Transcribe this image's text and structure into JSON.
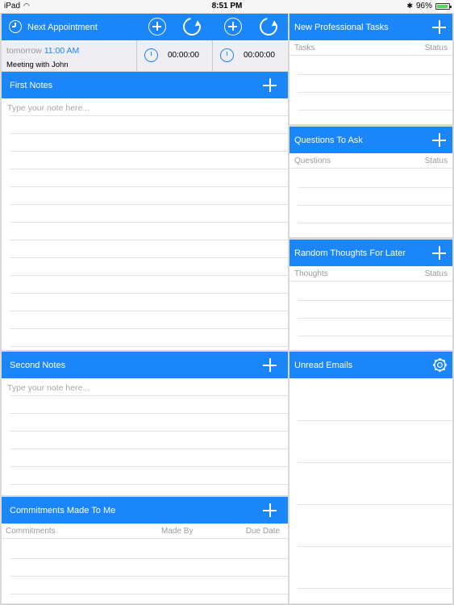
{
  "status_bar": {
    "device": "iPad",
    "time": "8:51 PM",
    "battery": "96%",
    "battery_level": 0.96
  },
  "appointment": {
    "title": "Next Appointment",
    "day": "tomorrow",
    "time": "11:00 AM",
    "description": "Meeting with John",
    "timer1": "00:00:00",
    "timer2": "00:00:00"
  },
  "first_notes": {
    "title": "First Notes",
    "placeholder": "Type your note here..."
  },
  "second_notes": {
    "title": "Second Notes",
    "placeholder": "Type your note here..."
  },
  "commitments": {
    "title": "Commitments Made To Me",
    "col1": "Commitments",
    "col2": "Made By",
    "col3": "Due Date"
  },
  "professional_tasks": {
    "title": "New Professional Tasks",
    "col1": "Tasks",
    "col2": "Status"
  },
  "questions": {
    "title": "Questions To Ask",
    "col1": "Questions",
    "col2": "Status"
  },
  "thoughts": {
    "title": "Random Thoughts For Later",
    "col1": "Thoughts",
    "col2": "Status"
  },
  "emails": {
    "title": "Unread Emails"
  },
  "colors": {
    "accent": "#1b85fa",
    "background": "#d8d8d8",
    "row_line": "#e3e3e3"
  }
}
